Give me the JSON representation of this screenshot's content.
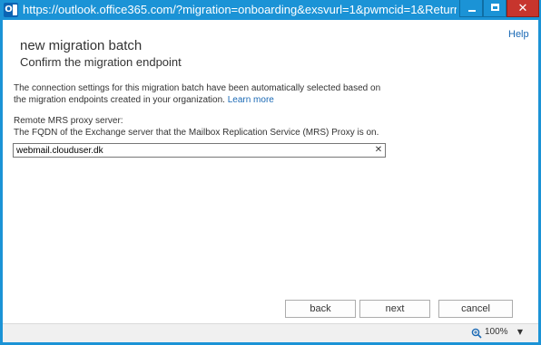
{
  "window": {
    "icon": "outlook-icon",
    "icon_letter": "O",
    "title": "https://outlook.office365.com/?migration=onboarding&exsvurl=1&pwmcid=1&ReturnObje...",
    "controls": {
      "minimize": "minimize-icon",
      "maximize": "maximize-icon",
      "close": "close-icon",
      "close_glyph": "✕"
    }
  },
  "help": {
    "label": "Help"
  },
  "page": {
    "title": "new migration batch",
    "subtitle": "Confirm the migration endpoint",
    "description": "The connection settings for this migration batch have been automatically selected based on the migration endpoints created in your organization.",
    "learn_more": "Learn more"
  },
  "field": {
    "label": "Remote MRS proxy server:",
    "description": "The FQDN of the Exchange server that the Mailbox Replication Service (MRS) Proxy is on.",
    "value": "webmail.clouduser.dk",
    "clear_glyph": "✕"
  },
  "buttons": {
    "back": "back",
    "next": "next",
    "cancel": "cancel"
  },
  "status": {
    "zoom": "100%",
    "dropdown_glyph": "▼"
  },
  "colors": {
    "titlebar": "#1b93d6",
    "close": "#c7352d",
    "link": "#1a69b5"
  }
}
